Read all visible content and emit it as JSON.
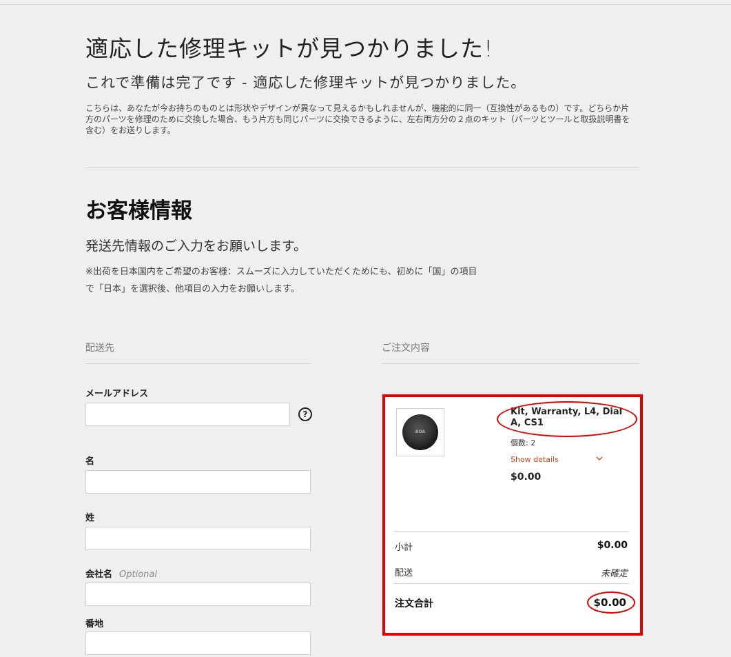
{
  "header": {
    "title": "適応した修理キットが見つかりました!",
    "subtitle": "これで準備は完了です - 適応した修理キットが見つかりました。",
    "description": "こちらは、あなたが今お持ちのものとは形状やデザインが異なって見えるかもしれませんが、機能的に同一（互換性があるもの）です。どちらか片方のパーツを修理のために交換した場合、もう片方も同じパーツに交換できるように、左右両方分の２点のキット（パーツとツールと取扱説明書を含む）をお送りします。"
  },
  "customer": {
    "title": "お客様情報",
    "subtitle": "発送先情報のご入力をお願いします。",
    "note": "※出荷を日本国内をご希望のお客様：スムーズに入力していただくためにも、初めに「国」の項目で「日本」を選択後、他項目の入力をお願いします。"
  },
  "shipping": {
    "heading": "配送先",
    "email_label": "メールアドレス",
    "help_icon": "?",
    "first_name_label": "名",
    "last_name_label": "姓",
    "company_label": "会社名",
    "optional_label": "Optional",
    "street_label": "番地"
  },
  "order": {
    "heading": "ご注文内容",
    "product_name": "Kit, Warranty, L4, Dial A, CS1",
    "quantity": "個数: 2",
    "show_details": "Show details",
    "product_price": "$0.00",
    "thumbnail_text": "BOA",
    "subtotal_label": "小計",
    "subtotal_value": "$0.00",
    "shipping_label": "配送",
    "shipping_value": "未確定",
    "total_label": "注文合計",
    "total_value": "$0.00"
  },
  "colors": {
    "background": "#efefef",
    "highlight": "#e10000",
    "link": "#d0431f"
  }
}
